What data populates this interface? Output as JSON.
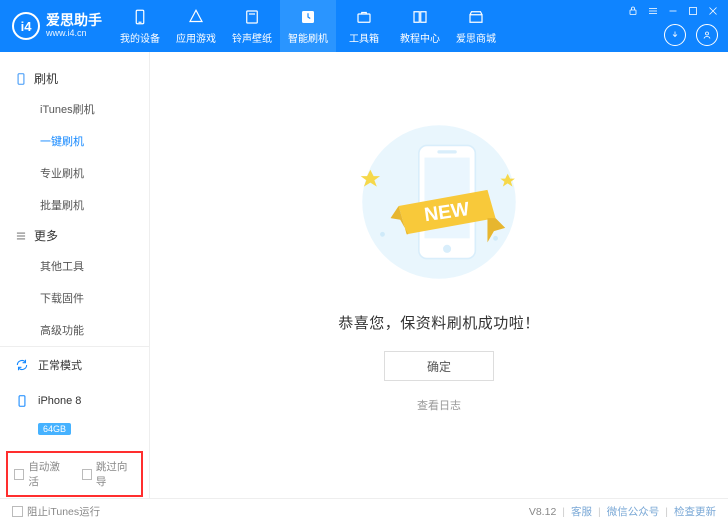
{
  "brand": {
    "logo": "i4",
    "name_cn": "爱思助手",
    "url": "www.i4.cn"
  },
  "tabs": [
    {
      "label": "我的设备"
    },
    {
      "label": "应用游戏"
    },
    {
      "label": "铃声壁纸"
    },
    {
      "label": "智能刷机"
    },
    {
      "label": "工具箱"
    },
    {
      "label": "教程中心"
    },
    {
      "label": "爱思商城"
    }
  ],
  "sidebar": {
    "group1_title": "刷机",
    "items1": [
      {
        "label": "iTunes刷机"
      },
      {
        "label": "一键刷机"
      },
      {
        "label": "专业刷机"
      },
      {
        "label": "批量刷机"
      }
    ],
    "group2_title": "更多",
    "items2": [
      {
        "label": "其他工具"
      },
      {
        "label": "下载固件"
      },
      {
        "label": "高级功能"
      }
    ],
    "mode": "正常模式",
    "device": "iPhone 8",
    "storage": "64GB",
    "options": {
      "auto_activate": "自动激活",
      "skip_guide": "跳过向导"
    }
  },
  "main": {
    "new_badge": "NEW",
    "message": "恭喜您，保资料刷机成功啦！",
    "confirm": "确定",
    "log": "查看日志"
  },
  "footer": {
    "block_itunes": "阻止iTunes运行",
    "version": "V8.12",
    "service": "客服",
    "wechat": "微信公众号",
    "check_update": "检查更新"
  }
}
